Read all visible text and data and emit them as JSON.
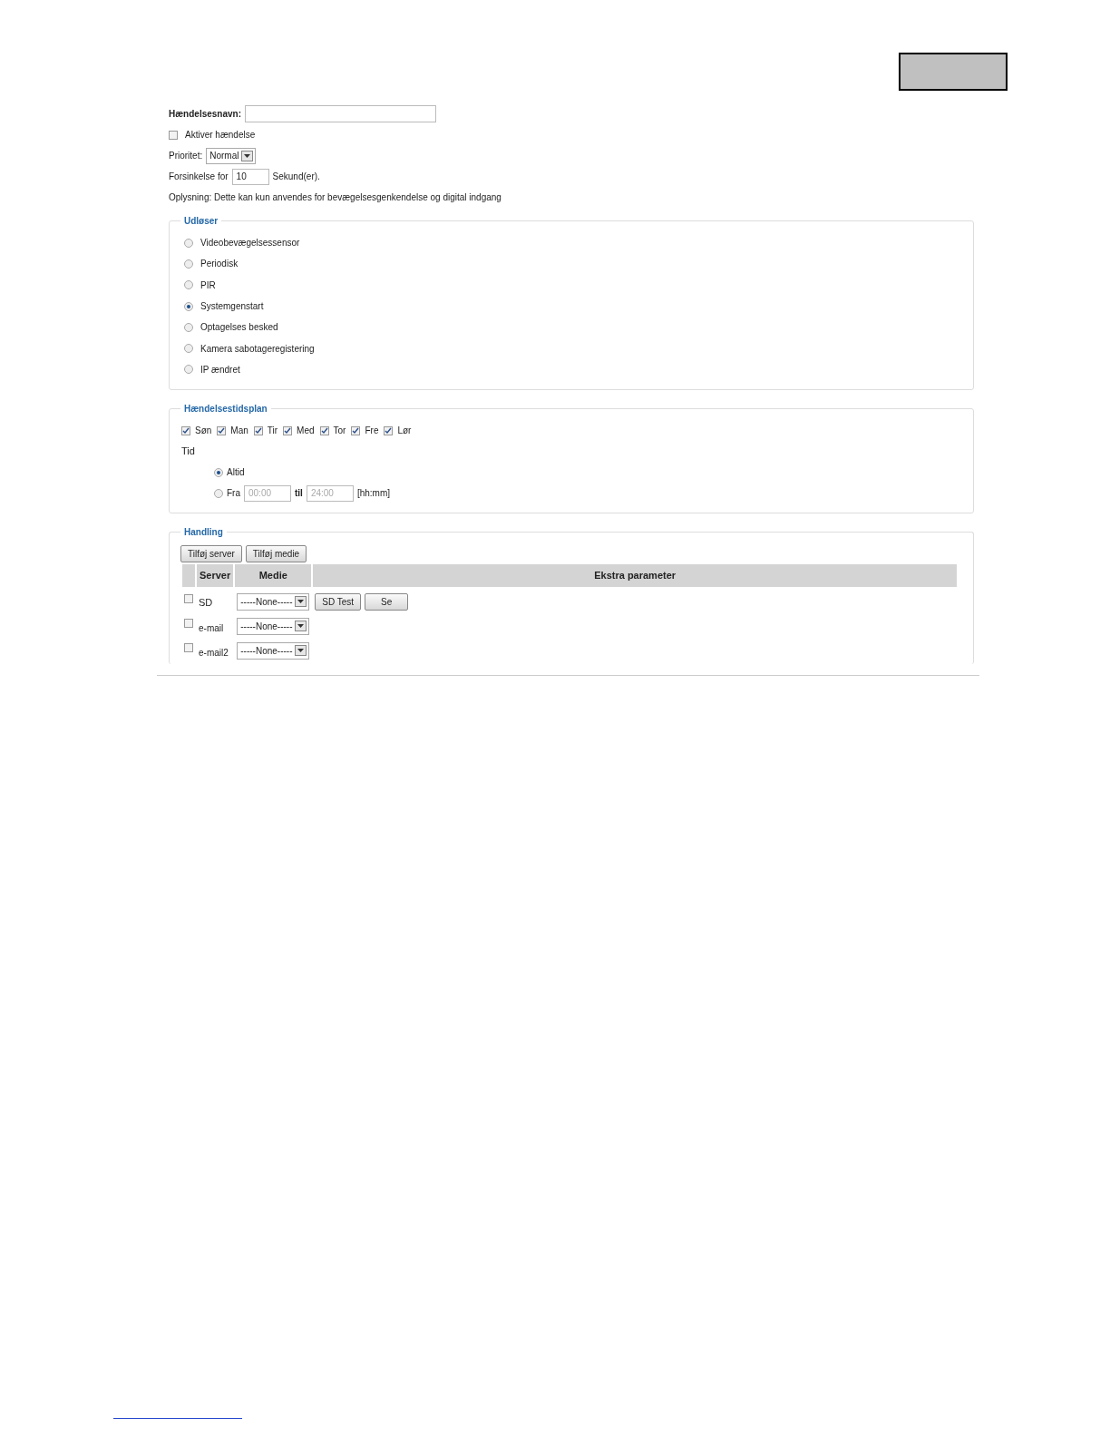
{
  "event_name": {
    "label": "Hændelsesnavn:"
  },
  "enable": {
    "label": "Aktiver hændelse",
    "checked": false
  },
  "priority": {
    "label": "Prioritet:",
    "value": "Normal"
  },
  "delay": {
    "label": "Forsinkelse for",
    "value": "10",
    "unit": "Sekund(er)."
  },
  "note": "Oplysning: Dette kan kun anvendes for bevægelsesgenkendelse og digital indgang",
  "trigger": {
    "title": "Udløser",
    "options": [
      {
        "label": "Videobevægelsessensor",
        "selected": false
      },
      {
        "label": "Periodisk",
        "selected": false
      },
      {
        "label": "PIR",
        "selected": false
      },
      {
        "label": "Systemgenstart",
        "selected": true
      },
      {
        "label": "Optagelses besked",
        "selected": false
      },
      {
        "label": "Kamera sabotageregistering",
        "selected": false
      },
      {
        "label": "IP ændret",
        "selected": false
      }
    ]
  },
  "schedule": {
    "title": "Hændelsestidsplan",
    "days": [
      {
        "label": "Søn",
        "checked": true
      },
      {
        "label": "Man",
        "checked": true
      },
      {
        "label": "Tir",
        "checked": true
      },
      {
        "label": "Med",
        "checked": true
      },
      {
        "label": "Tor",
        "checked": true
      },
      {
        "label": "Fre",
        "checked": true
      },
      {
        "label": "Lør",
        "checked": true
      }
    ],
    "time_label": "Tid",
    "time_options": [
      {
        "kind": "always",
        "label": "Altid",
        "selected": true
      },
      {
        "kind": "range",
        "label": "Fra",
        "from": "00:00",
        "to_label": "til",
        "to": "24:00",
        "format": "[hh:mm]",
        "selected": false
      }
    ]
  },
  "action": {
    "title": "Handling",
    "buttons": [
      "Tilføj server",
      "Tilføj medie"
    ],
    "columns": [
      "Server",
      "Medie",
      "Ekstra parameter"
    ],
    "rows": [
      {
        "checked": false,
        "server": "SD",
        "media": "-----None-----",
        "buttons": [
          "SD Test",
          "Se"
        ]
      },
      {
        "checked": false,
        "server": "e-mail",
        "media": "-----None-----"
      },
      {
        "checked": false,
        "server": "e-mail2",
        "media": "-----None-----"
      }
    ]
  }
}
